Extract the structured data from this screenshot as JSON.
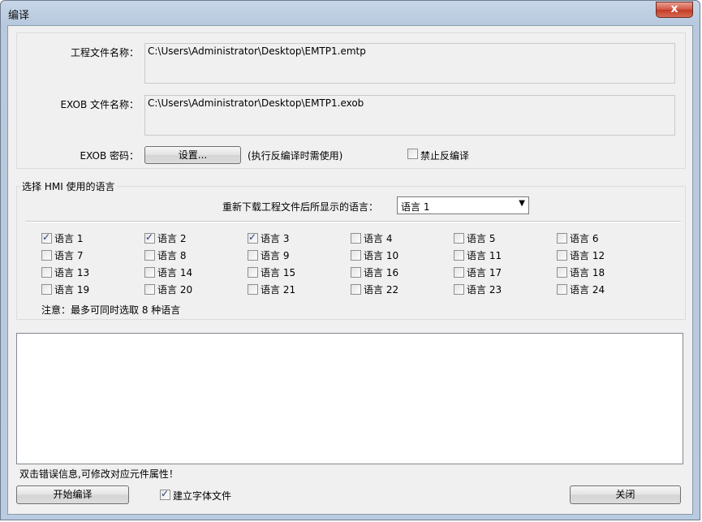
{
  "window": {
    "title": "编译",
    "close_label": "x"
  },
  "files": {
    "project_label": "工程文件名称：",
    "project_path": "C:\\Users\\Administrator\\Desktop\\EMTP1.emtp",
    "exob_label": "EXOB 文件名称：",
    "exob_path": "C:\\Users\\Administrator\\Desktop\\EMTP1.exob",
    "password_label": "EXOB 密码：",
    "settings_button": "设置...",
    "password_note": "(执行反编译时需使用)",
    "disable_decompile_label": "禁止反编译",
    "disable_decompile_checked": false
  },
  "language": {
    "group_title": "选择 HMI 使用的语言",
    "display_label": "重新下载工程文件后所显示的语言：",
    "display_value": "语言 1",
    "items": [
      {
        "label": "语言 1",
        "checked": true
      },
      {
        "label": "语言 2",
        "checked": true
      },
      {
        "label": "语言 3",
        "checked": true
      },
      {
        "label": "语言 4",
        "checked": false
      },
      {
        "label": "语言 5",
        "checked": false
      },
      {
        "label": "语言 6",
        "checked": false
      },
      {
        "label": "语言 7",
        "checked": false
      },
      {
        "label": "语言 8",
        "checked": false
      },
      {
        "label": "语言 9",
        "checked": false
      },
      {
        "label": "语言 10",
        "checked": false
      },
      {
        "label": "语言 11",
        "checked": false
      },
      {
        "label": "语言 12",
        "checked": false
      },
      {
        "label": "语言 13",
        "checked": false
      },
      {
        "label": "语言 14",
        "checked": false
      },
      {
        "label": "语言 15",
        "checked": false
      },
      {
        "label": "语言 16",
        "checked": false
      },
      {
        "label": "语言 17",
        "checked": false
      },
      {
        "label": "语言 18",
        "checked": false
      },
      {
        "label": "语言 19",
        "checked": false
      },
      {
        "label": "语言 20",
        "checked": false
      },
      {
        "label": "语言 21",
        "checked": false
      },
      {
        "label": "语言 22",
        "checked": false
      },
      {
        "label": "语言 23",
        "checked": false
      },
      {
        "label": "语言 24",
        "checked": false
      }
    ],
    "note": "注意：最多可同时选取 8 种语言"
  },
  "footer": {
    "hint": "双击错误信息,可修改对应元件属性！",
    "start_button": "开始编译",
    "font_file_label": "建立字体文件",
    "font_file_checked": true,
    "close_button": "关闭"
  },
  "colors": {
    "window_frame": "#b9cbe0",
    "client_bg": "#f0f0f0",
    "close_button": "#c9452f"
  }
}
